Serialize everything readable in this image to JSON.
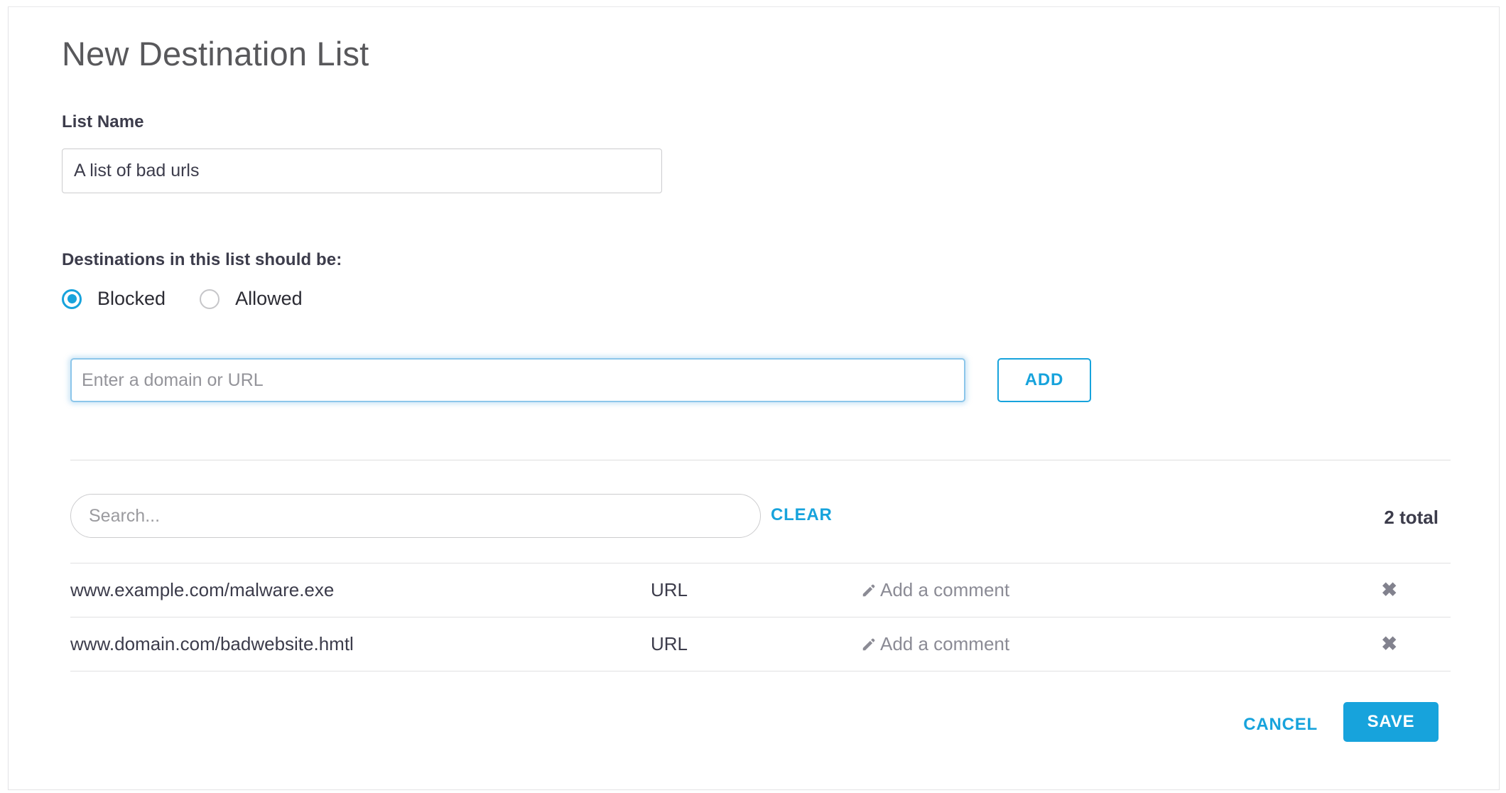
{
  "page": {
    "title": "New Destination List"
  },
  "list_name": {
    "label": "List Name",
    "value": "A list of bad urls",
    "placeholder": ""
  },
  "destination_type": {
    "label": "Destinations in this list should be:",
    "options": [
      {
        "label": "Blocked",
        "selected": true
      },
      {
        "label": "Allowed",
        "selected": false
      }
    ]
  },
  "entry": {
    "placeholder": "Enter a domain or URL",
    "value": "",
    "add_label": "ADD"
  },
  "search": {
    "placeholder": "Search...",
    "value": "",
    "clear_label": "CLEAR",
    "total_label": "2 total"
  },
  "table": {
    "rows": [
      {
        "destination": "www.example.com/malware.exe",
        "type": "URL",
        "comment": "Add a comment",
        "delete_glyph": "✖"
      },
      {
        "destination": "www.domain.com/badwebsite.hmtl",
        "type": "URL",
        "comment": "Add a comment",
        "delete_glyph": "✖"
      }
    ]
  },
  "footer": {
    "cancel_label": "CANCEL",
    "save_label": "SAVE"
  },
  "colors": {
    "accent": "#17a3dc",
    "text_dark": "#3c3c4b",
    "text_muted": "#8b8b95",
    "border": "#ccccce"
  }
}
